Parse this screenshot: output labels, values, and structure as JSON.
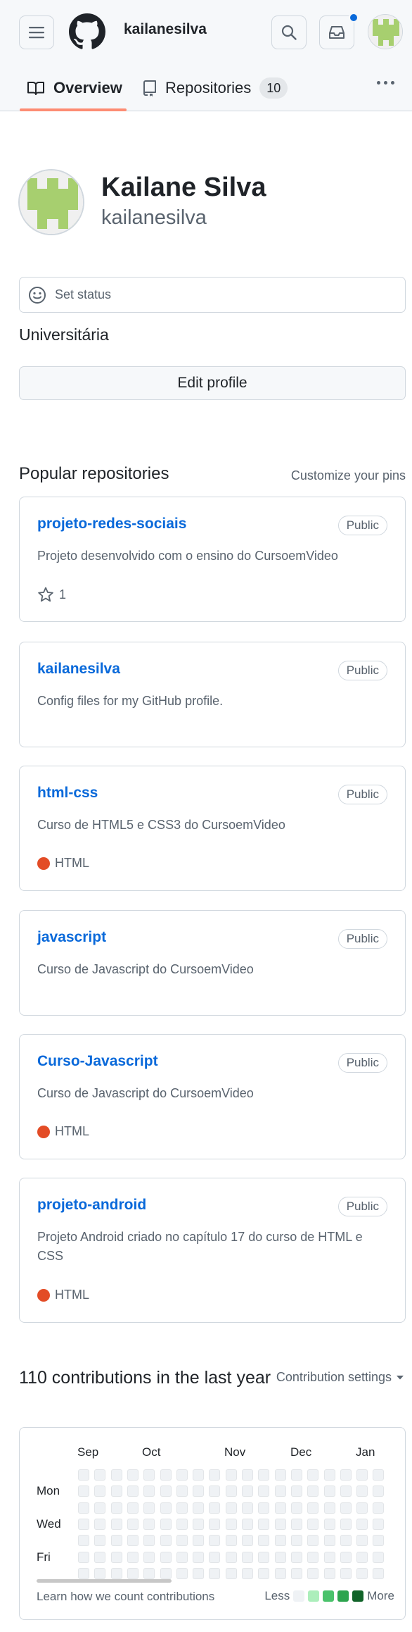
{
  "header": {
    "username": "kailanesilva"
  },
  "tabs": [
    {
      "label": "Overview"
    },
    {
      "label": "Repositories",
      "count": "10"
    }
  ],
  "profile": {
    "full_name": "Kailane Silva",
    "login": "kailanesilva",
    "status_placeholder": "Set status",
    "bio": "Universitária",
    "edit_profile_label": "Edit profile"
  },
  "popular": {
    "title": "Popular repositories",
    "customize_label": "Customize your pins",
    "repos": [
      {
        "name": "projeto-redes-sociais",
        "visibility": "Public",
        "description": "Projeto desenvolvido com o ensino do CursoemVideo",
        "stars": "1"
      },
      {
        "name": "kailanesilva",
        "visibility": "Public",
        "description": "Config files for my GitHub profile."
      },
      {
        "name": "html-css",
        "visibility": "Public",
        "description": "Curso de HTML5 e CSS3 do CursoemVideo",
        "language": "HTML",
        "language_color": "#e34c26"
      },
      {
        "name": "javascript",
        "visibility": "Public",
        "description": "Curso de Javascript do CursoemVideo"
      },
      {
        "name": "Curso-Javascript",
        "visibility": "Public",
        "description": "Curso de Javascript do CursoemVideo",
        "language": "HTML",
        "language_color": "#e34c26"
      },
      {
        "name": "projeto-android",
        "visibility": "Public",
        "description": "Projeto Android criado no capítulo 17 do curso de HTML e CSS",
        "language": "HTML",
        "language_color": "#e34c26"
      }
    ]
  },
  "contributions": {
    "title": "110 contributions in the last year",
    "settings_label": "Contribution settings",
    "months": [
      "Sep",
      "Oct",
      "Nov",
      "Dec",
      "Jan"
    ],
    "days": [
      "Mon",
      "Wed",
      "Fri"
    ],
    "learn_label": "Learn how we count contributions",
    "legend_less": "Less",
    "legend_more": "More",
    "legend_colors": [
      "#eff2f5",
      "#aceebb",
      "#4ac26b",
      "#2da44e",
      "#116329"
    ]
  },
  "colors": {
    "accent_link": "#0969da",
    "tab_underline": "#fd8c73",
    "notification": "#0969da",
    "identicon": "#a7cf6f"
  }
}
